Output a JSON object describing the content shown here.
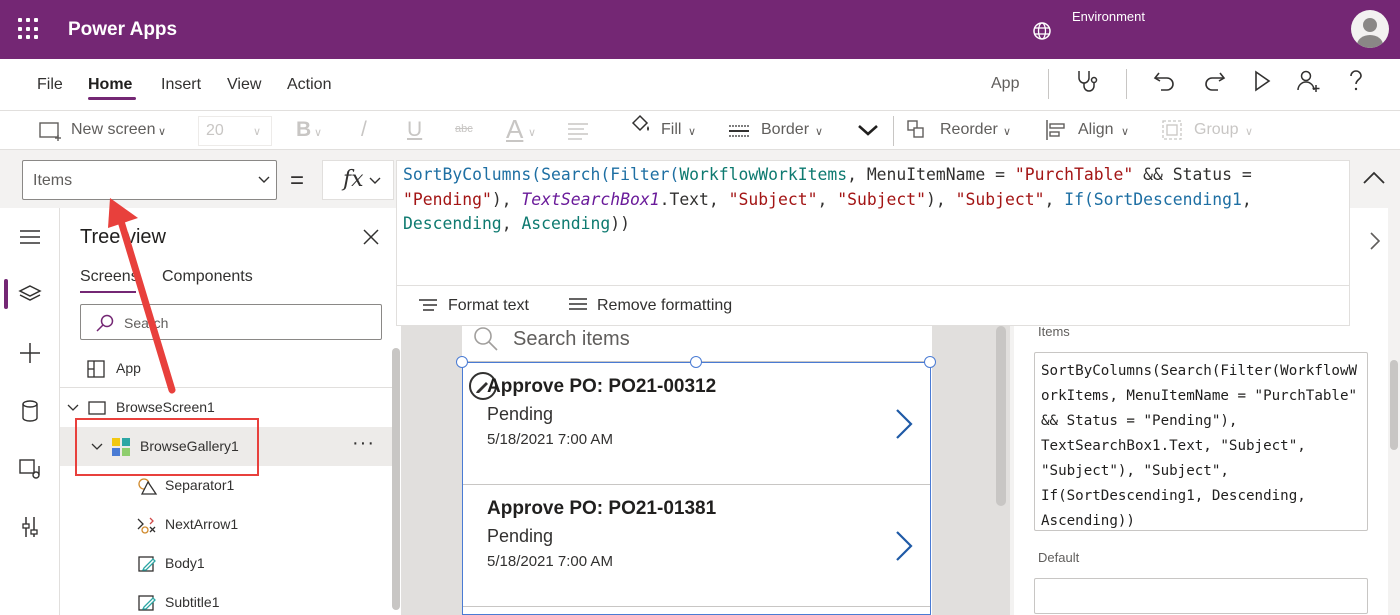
{
  "titlebar": {
    "app_title": "Power Apps",
    "environment_label": "Environment",
    "icons": [
      "waffle-icon",
      "globe-icon",
      "avatar-icon"
    ]
  },
  "menubar": {
    "items": [
      "File",
      "Home",
      "Insert",
      "View",
      "Action"
    ],
    "active": "Home",
    "app_label": "App",
    "icons": [
      "stethoscope-icon",
      "undo-icon",
      "redo-icon",
      "play-icon",
      "share-user-icon",
      "help-icon"
    ]
  },
  "toolbar": {
    "new_screen": "New screen",
    "font_size": "20",
    "bold": "B",
    "italic": "/",
    "underline": "U",
    "strikethrough": "abc",
    "font_color": "A",
    "fill": "Fill",
    "border": "Border",
    "reorder": "Reorder",
    "align": "Align",
    "group": "Group"
  },
  "formula_bar": {
    "property": "Items",
    "equals": "=",
    "fx": "fx",
    "formula_parts": [
      {
        "t": "SortByColumns(Search(Filter(",
        "c": "func"
      },
      {
        "t": "WorkflowWorkItems",
        "c": "data"
      },
      {
        "t": ", MenuItemName = ",
        "c": "plain"
      },
      {
        "t": "\"PurchTable\"",
        "c": "str"
      },
      {
        "t": " && Status = ",
        "c": "plain"
      },
      {
        "t": "\"Pending\"",
        "c": "str"
      },
      {
        "t": "), ",
        "c": "plain"
      },
      {
        "t": "TextSearchBox1",
        "c": "ctrl"
      },
      {
        "t": ".Text, ",
        "c": "plain"
      },
      {
        "t": "\"Subject\"",
        "c": "str"
      },
      {
        "t": ", ",
        "c": "plain"
      },
      {
        "t": "\"Subject\"",
        "c": "str"
      },
      {
        "t": "), ",
        "c": "plain"
      },
      {
        "t": "\"Subject\"",
        "c": "str"
      },
      {
        "t": ", ",
        "c": "plain"
      },
      {
        "t": "If(SortDescending1",
        "c": "func"
      },
      {
        "t": ", ",
        "c": "plain"
      },
      {
        "t": "Descending",
        "c": "data"
      },
      {
        "t": ", ",
        "c": "plain"
      },
      {
        "t": "Ascending",
        "c": "data"
      },
      {
        "t": "))",
        "c": "plain"
      }
    ],
    "format_text": "Format text",
    "remove_formatting": "Remove formatting"
  },
  "treeview": {
    "title": "Tree view",
    "tabs": [
      "Screens",
      "Components"
    ],
    "search_placeholder": "Search",
    "rows": [
      {
        "label": "App",
        "icon": "app-icon",
        "indent": 0
      },
      {
        "label": "BrowseScreen1",
        "icon": "screen-icon",
        "indent": 0,
        "expanded": true
      },
      {
        "label": "BrowseGallery1",
        "icon": "gallery-icon",
        "indent": 1,
        "expanded": true,
        "selected": true
      },
      {
        "label": "Separator1",
        "icon": "shapes-icon",
        "indent": 2
      },
      {
        "label": "NextArrow1",
        "icon": "shapes-icon",
        "indent": 2
      },
      {
        "label": "Body1",
        "icon": "label-edit-icon",
        "indent": 2
      },
      {
        "label": "Subtitle1",
        "icon": "label-edit-icon",
        "indent": 2
      }
    ],
    "more_menu": "···"
  },
  "canvas": {
    "search_placeholder": "Search items",
    "gallery_items": [
      {
        "title": "Approve PO: PO21-00312",
        "status": "Pending",
        "date": "5/18/2021 7:00 AM"
      },
      {
        "title": "Approve PO: PO21-01381",
        "status": "Pending",
        "date": "5/18/2021 7:00 AM"
      }
    ]
  },
  "properties": {
    "items_label": "Items",
    "items_value": "SortByColumns(Search(Filter(WorkflowWorkItems, MenuItemName = \"PurchTable\" && Status = \"Pending\"), TextSearchBox1.Text, \"Subject\", \"Subject\"), \"Subject\", If(SortDescending1, Descending, Ascending))",
    "items_lines": [
      "SortByColumns(Search(Filter(WorkflowW",
      "orkItems, MenuItemName = \"PurchTable\"",
      "&& Status = \"Pending\"),",
      "TextSearchBox1.Text, \"Subject\",",
      "\"Subject\"), \"Subject\",",
      "If(SortDescending1, Descending,",
      "Ascending))"
    ],
    "default_label": "Default",
    "default_value": ""
  },
  "colors": {
    "brand": "#742774",
    "selection": "#4a7bd4",
    "annotation": "#e8403c"
  }
}
